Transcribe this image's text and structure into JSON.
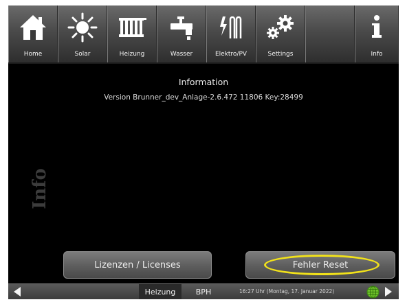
{
  "nav": {
    "items": [
      {
        "label": "Home",
        "icon": "home-icon"
      },
      {
        "label": "Solar",
        "icon": "sun-icon"
      },
      {
        "label": "Heizung",
        "icon": "radiator-icon"
      },
      {
        "label": "Wasser",
        "icon": "faucet-icon"
      },
      {
        "label": "Elektro/PV",
        "icon": "heating-element-icon"
      },
      {
        "label": "Settings",
        "icon": "gears-icon"
      },
      {
        "label": "",
        "icon": ""
      },
      {
        "label": "Info",
        "icon": "info-icon"
      }
    ]
  },
  "main": {
    "title": "Information",
    "version": "Version Brunner_dev_Anlage-2.6.472 11806 Key:28499",
    "side_label": "Info"
  },
  "buttons": {
    "licenses": "Lizenzen / Licenses",
    "reset": "Fehler Reset"
  },
  "statusbar": {
    "tab_active": "Heizung",
    "tab_other": "BPH",
    "datetime": "16:27 Uhr (Montag, 17. Januar 2022)"
  },
  "colors": {
    "background": "#000000",
    "highlight": "#f2e21a",
    "globe": "#6fc12b"
  }
}
